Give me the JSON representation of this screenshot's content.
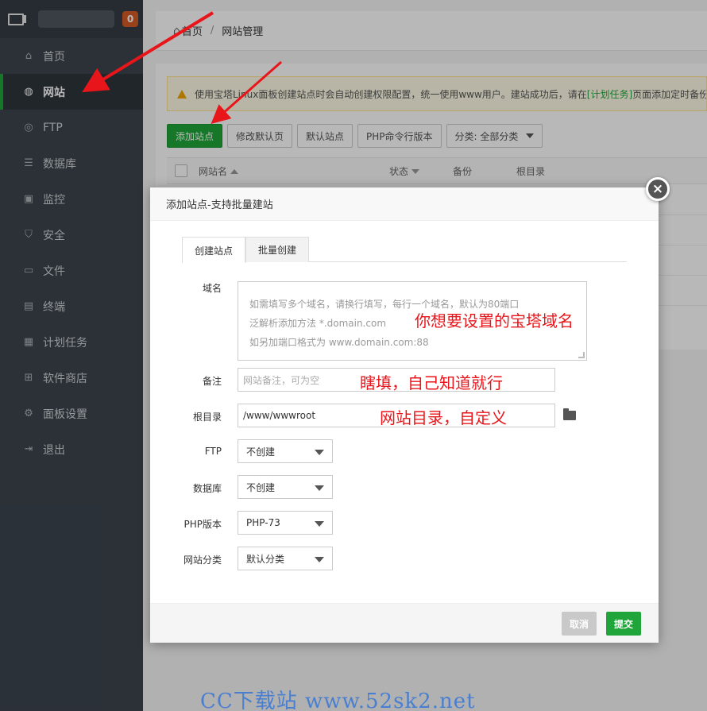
{
  "sidebar": {
    "badge": "0",
    "items": [
      {
        "label": "首页",
        "icon": "home-icon"
      },
      {
        "label": "网站",
        "icon": "globe-icon"
      },
      {
        "label": "FTP",
        "icon": "ftp-icon"
      },
      {
        "label": "数据库",
        "icon": "database-icon"
      },
      {
        "label": "监控",
        "icon": "monitor-icon"
      },
      {
        "label": "安全",
        "icon": "shield-icon"
      },
      {
        "label": "文件",
        "icon": "folder-icon"
      },
      {
        "label": "终端",
        "icon": "terminal-icon"
      },
      {
        "label": "计划任务",
        "icon": "calendar-icon"
      },
      {
        "label": "软件商店",
        "icon": "grid-icon"
      },
      {
        "label": "面板设置",
        "icon": "gear-icon"
      },
      {
        "label": "退出",
        "icon": "logout-icon"
      }
    ],
    "active_index": 1
  },
  "breadcrumb": {
    "home": "首页",
    "separator": "/",
    "current": "网站管理"
  },
  "notice": {
    "text_before": "使用宝塔Linux面板创建站点时会自动创建权限配置，统一使用www用户。建站成功后，请在",
    "link": "[计划任务]",
    "text_after": "页面添加定时备份"
  },
  "toolbar": {
    "add_site": "添加站点",
    "modify_default_page": "修改默认页",
    "default_site": "默认站点",
    "php_cli": "PHP命令行版本",
    "category": "分类: 全部分类"
  },
  "table": {
    "columns": [
      "网站名",
      "状态",
      "备份",
      "根目录"
    ]
  },
  "modal": {
    "title": "添加站点-支持批量建站",
    "close": "×",
    "tabs": [
      "创建站点",
      "批量创建"
    ],
    "fields": {
      "domain_label": "域名",
      "domain_placeholder_lines": [
        "如需填写多个域名，请换行填写，每行一个域名，默认为80端口",
        "泛解析添加方法 *.domain.com",
        "如另加端口格式为 www.domain.com:88"
      ],
      "remark_label": "备注",
      "remark_placeholder": "网站备注，可为空",
      "root_label": "根目录",
      "root_value": "/www/wwwroot",
      "ftp_label": "FTP",
      "ftp_value": "不创建",
      "db_label": "数据库",
      "db_value": "不创建",
      "php_label": "PHP版本",
      "php_value": "PHP-73",
      "category_label": "网站分类",
      "category_value": "默认分类"
    },
    "cancel": "取消",
    "submit": "提交"
  },
  "annotations": {
    "domain": "你想要设置的宝塔域名",
    "remark": "瞎填，自己知道就行",
    "root": "网站目录，自定义"
  },
  "watermark": "CC下载站 www.52sk2.net",
  "colors": {
    "accent_green": "#20a53a",
    "sidebar_bg": "#3c444d",
    "annotation_red": "#e8161b",
    "badge_orange": "#d35a25"
  }
}
